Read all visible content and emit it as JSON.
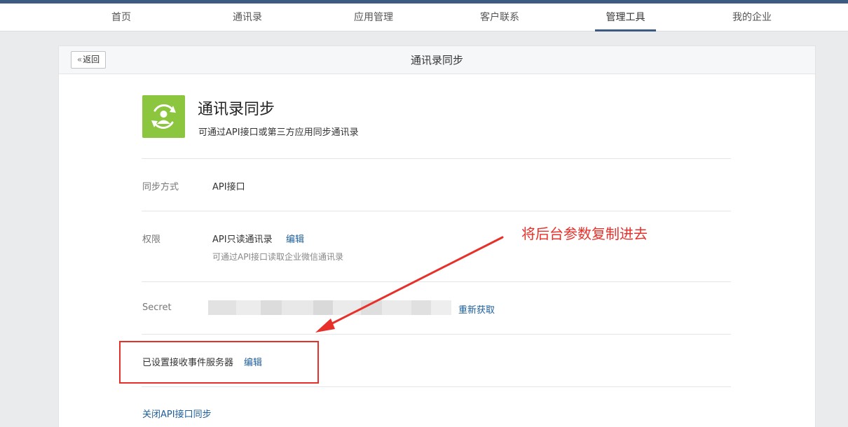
{
  "nav": {
    "items": [
      {
        "label": "首页"
      },
      {
        "label": "通讯录"
      },
      {
        "label": "应用管理"
      },
      {
        "label": "客户联系"
      },
      {
        "label": "管理工具"
      },
      {
        "label": "我的企业"
      }
    ],
    "active_index": 4,
    "accent_color": "#3d5a80"
  },
  "header": {
    "back_label": "返回",
    "title": "通讯录同步"
  },
  "app": {
    "icon": "contact-sync-icon",
    "icon_color": "#8cc63f",
    "name": "通讯录同步",
    "description": "可通过API接口或第三方应用同步通讯录"
  },
  "rows": {
    "sync_method": {
      "label": "同步方式",
      "value": "API接口"
    },
    "permission": {
      "label": "权限",
      "value": "API只读通讯录",
      "edit_label": "编辑",
      "hint": "可通过API接口读取企业微信通讯录"
    },
    "secret": {
      "label": "Secret",
      "refresh_label": "重新获取"
    },
    "event_server": {
      "label": "已设置接收事件服务器",
      "edit_label": "编辑"
    },
    "close_label": "关闭API接口同步"
  },
  "annotation": {
    "text": "将后台参数复制进去",
    "color": "#e8302a"
  },
  "link_color": "#1c5d9b"
}
